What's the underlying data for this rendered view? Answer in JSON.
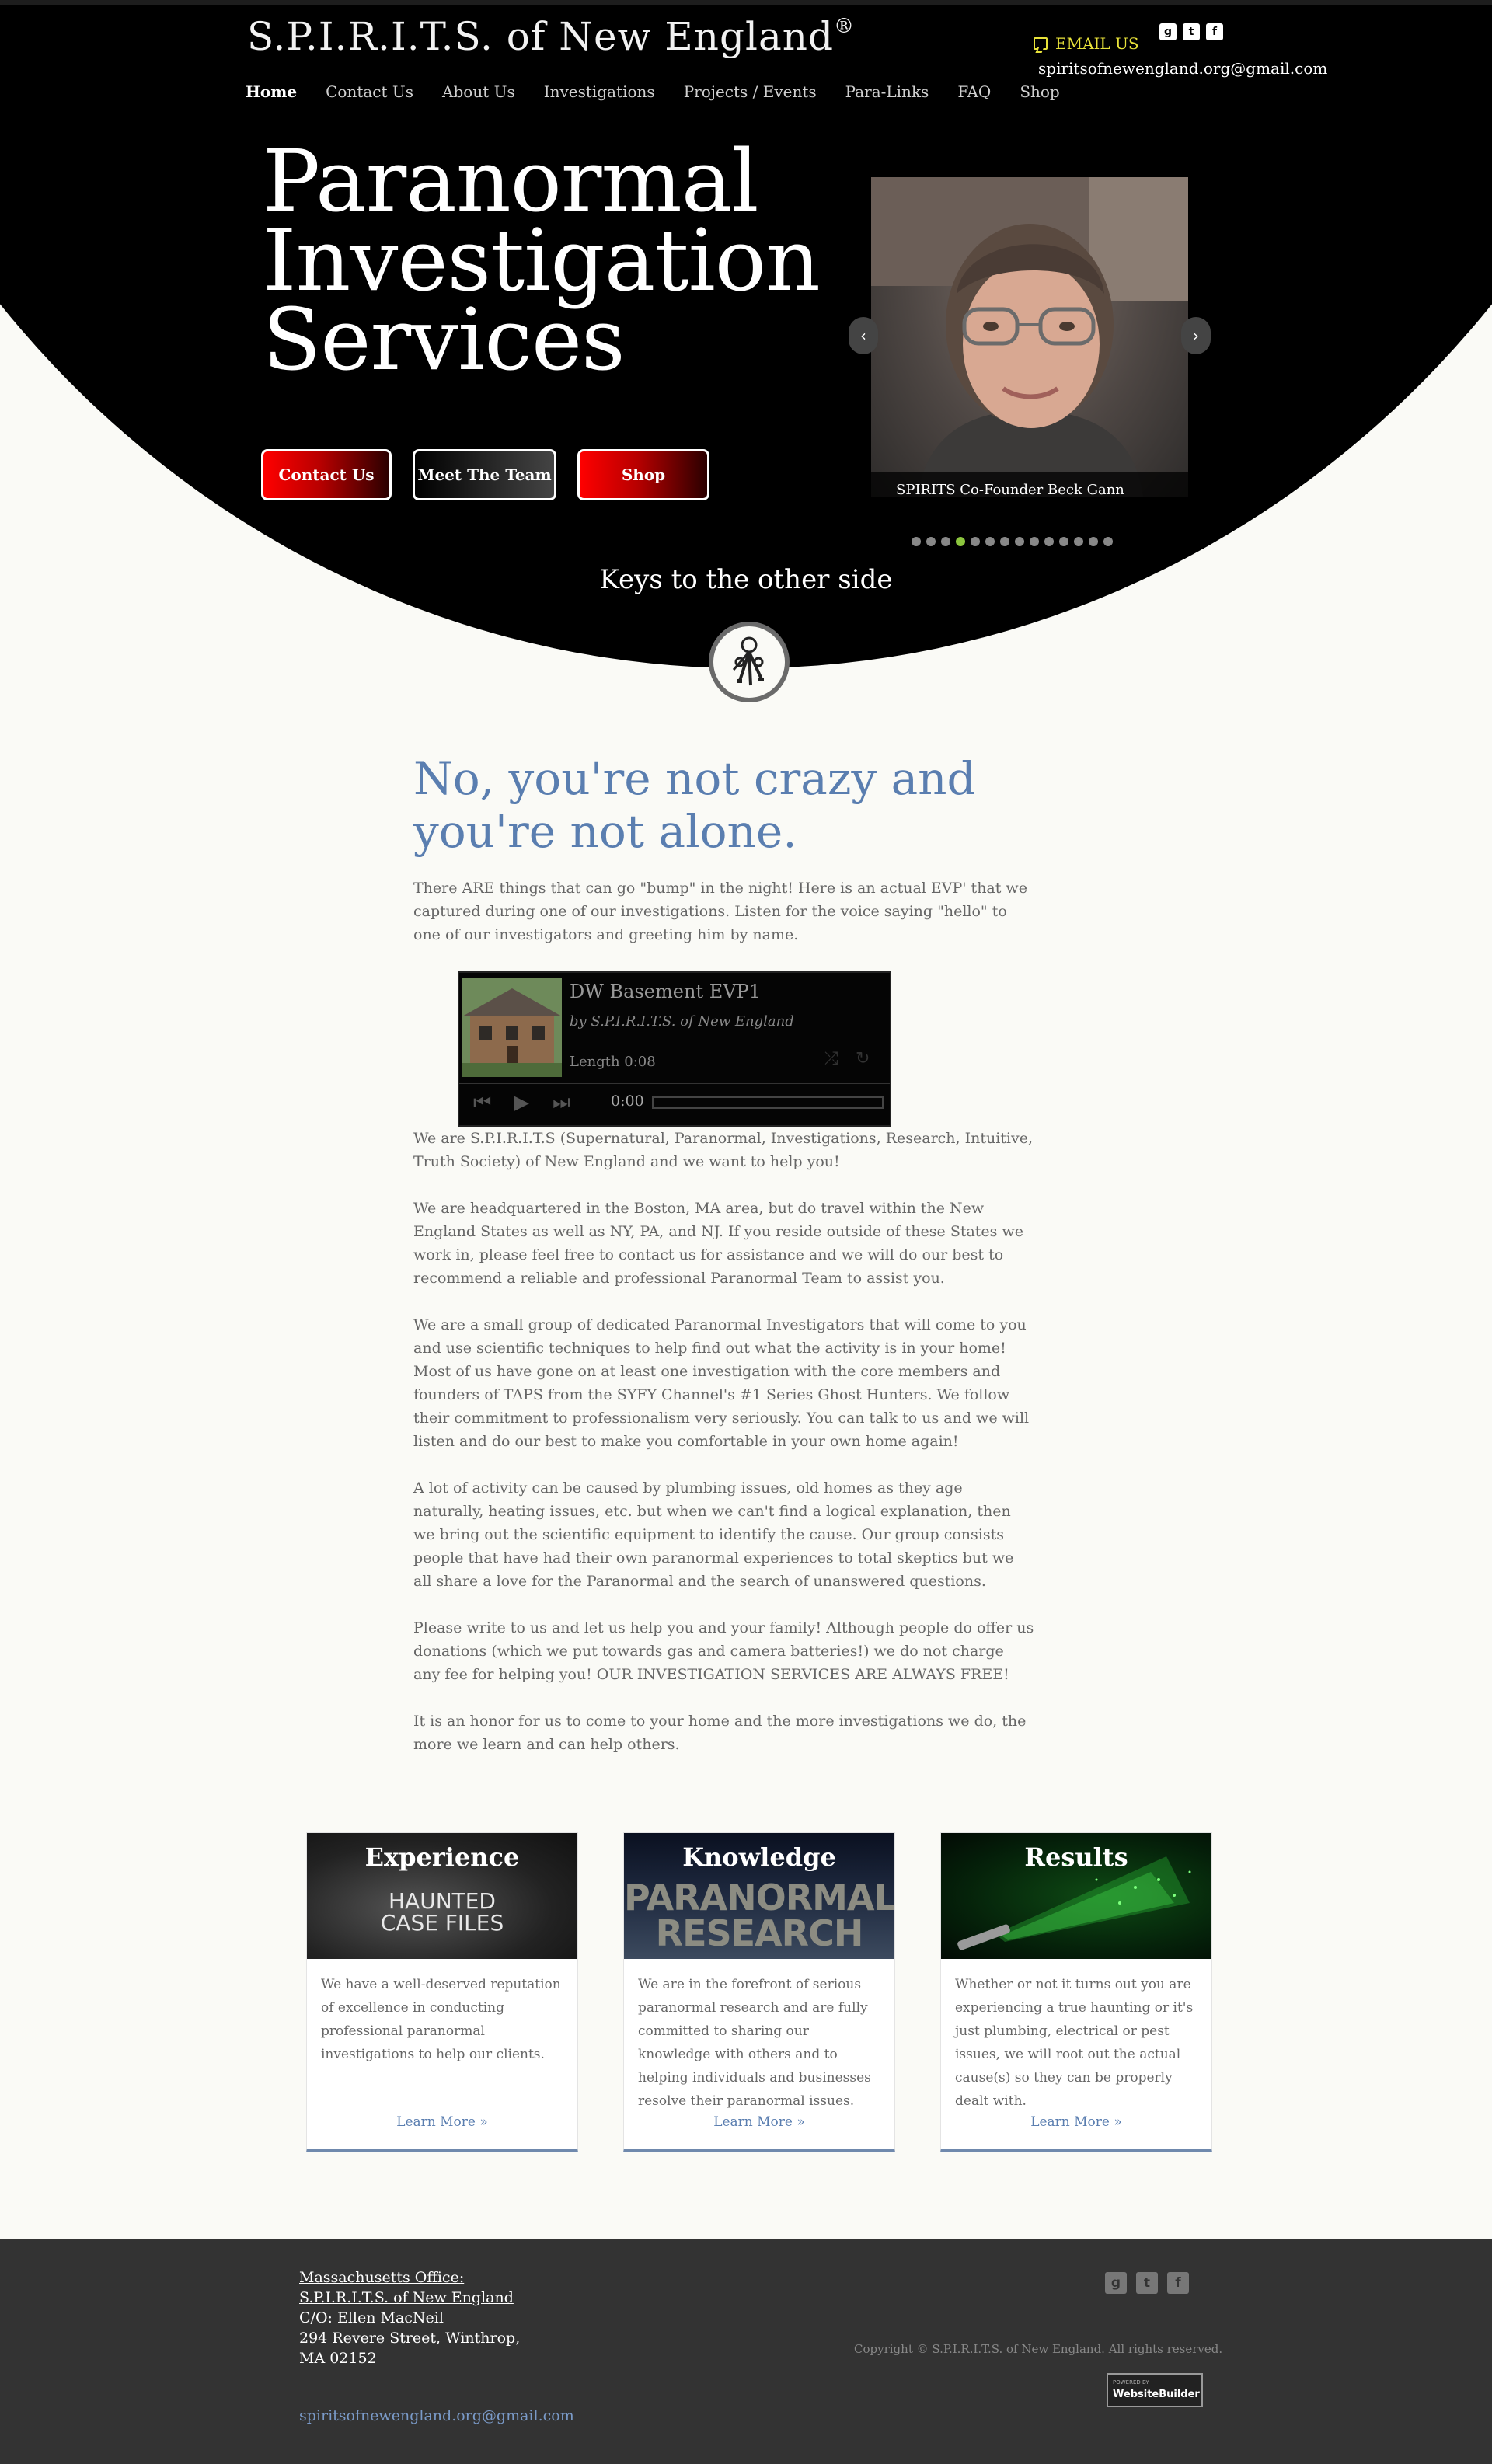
{
  "header": {
    "site_title": "S.P.I.R.I.T.S. of New England",
    "registered_mark": "®",
    "email_link_label": "EMAIL US",
    "email_address": "spiritsofnewengland.org@gmail.com",
    "social_icons": [
      "google-plus-icon",
      "twitter-icon",
      "facebook-icon"
    ]
  },
  "nav": {
    "items": [
      {
        "label": "Home",
        "active": true
      },
      {
        "label": "Contact Us"
      },
      {
        "label": "About Us"
      },
      {
        "label": "Investigations"
      },
      {
        "label": "Projects / Events"
      },
      {
        "label": "Para-Links"
      },
      {
        "label": "FAQ"
      },
      {
        "label": "Shop"
      }
    ]
  },
  "hero": {
    "heading_lines": [
      "Paranormal",
      "Investigation",
      "Services"
    ],
    "buttons": [
      "Contact Us",
      "Meet The Team",
      "Shop"
    ],
    "slider": {
      "caption": "SPIRITS Co-Founder Beck Gann",
      "prev_arrow": "‹",
      "next_arrow": "›",
      "dot_count": 14,
      "active_dot": 4
    },
    "tagline": "Keys to the other side",
    "badge_icon": "keys-icon"
  },
  "main": {
    "heading": "No, you're not crazy and you're not alone.",
    "intro": "There ARE things that can go \"bump\" in the night! Here is an actual EVP' that we captured during one of our investigations. Listen for the voice saying \"hello\" to one of our investigators and greeting him by name.",
    "player": {
      "title": "DW Basement EVP1",
      "by": "by S.P.I.R.I.T.S. of New England",
      "length": "Length 0:08",
      "time": "0:00"
    },
    "paragraphs": [
      "We are S.P.I.R.I.T.S (Supernatural, Paranormal, Investigations, Research, Intuitive, Truth Society) of New England and we want to help you!",
      "We are headquartered in the Boston, MA area, but do travel within the New England States as well as NY, PA, and NJ. If you reside outside of these States we work in, please feel free to contact us for assistance and we will do our best to recommend a reliable and professional Paranormal Team to assist you.",
      "We are a small group of dedicated Paranormal Investigators that will come to you and use scientific techniques to help find out what the activity is in your home! Most of us have gone on at least one investigation with the core members and founders of TAPS from the SYFY Channel's #1 Series Ghost Hunters. We follow their commitment to professionalism very seriously. You can talk to us and we will listen and do our best to make you comfortable in your own home again!",
      "A lot of activity can be caused by plumbing issues, old homes as they age naturally, heating issues, etc. but when we can't find a logical explanation, then we bring out the scientific equipment to identify the cause. Our group consists people that have had their own paranormal experiences to total skeptics but we all share a love for the Paranormal and the search of unanswered questions.",
      "Please write to us and let us help you and your family! Although people do offer us donations (which we put towards gas and camera batteries!) we do not charge any fee for helping you! OUR INVESTIGATION SERVICES ARE ALWAYS FREE!",
      "It is an honor for us to come to your home and the more investigations we do, the more we learn and can help others."
    ]
  },
  "cards": [
    {
      "title": "Experience",
      "image_text": [
        "HAUNTED",
        "CASE FILES"
      ],
      "text": "We have a well-deserved reputation of excellence in conducting professional paranormal investigations to help our clients.",
      "link": "Learn More »"
    },
    {
      "title": "Knowledge",
      "image_text": [
        "PARANORMAL",
        "RESEARCH"
      ],
      "text": "We are in the forefront of serious paranormal research and are fully committed to sharing our knowledge with others and to helping individuals and businesses resolve their paranormal issues.",
      "link": "Learn More »"
    },
    {
      "title": "Results",
      "text": "Whether or not it turns out you are experiencing a true haunting or it's just plumbing, electrical or pest issues, we will root out the actual cause(s) so they can be properly dealt with.",
      "link": "Learn More »"
    }
  ],
  "footer": {
    "office_label": "Massachusetts Office:",
    "org_name": "S.P.I.R.I.T.S. of New England",
    "address_lines": [
      "C/O: Ellen MacNeil",
      "294 Revere Street, Winthrop,",
      "MA 02152"
    ],
    "email": "spiritsofnewengland.org@gmail.com",
    "copyright": "Copyright © S.P.I.R.I.T.S. of New England. All rights reserved.",
    "badge_top": "POWERED BY",
    "badge_main": "WebsiteBuilder"
  },
  "colors": {
    "accent_blue": "#5a7eb0",
    "email_yellow": "#e8e23a",
    "hero_black": "#000000",
    "button_red": "#ff0000",
    "slider_active_dot": "#8cc63e",
    "footer_bg": "#333333"
  }
}
